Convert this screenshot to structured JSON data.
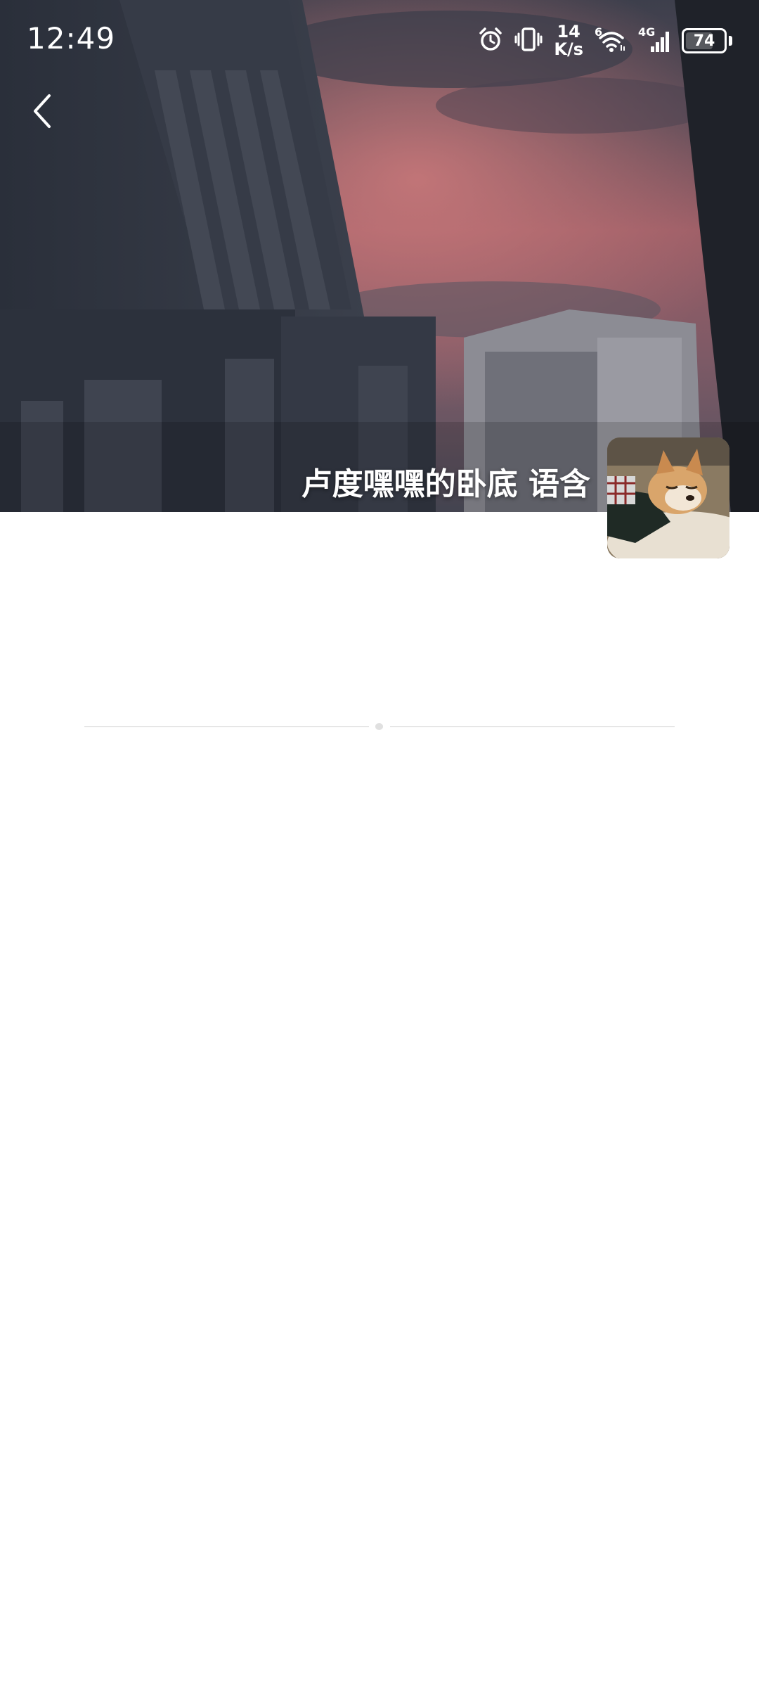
{
  "status_bar": {
    "time": "12:49",
    "net_speed_value": "14",
    "net_speed_unit": "K/s",
    "wifi_tag": "6",
    "cell_tag": "4G",
    "battery_level": "74",
    "battery_fraction": 0.74,
    "icons": [
      "alarm-icon",
      "vibrate-icon",
      "wifi-icon",
      "cell-signal-icon",
      "battery-icon"
    ]
  },
  "header": {
    "back_icon": "chevron-left-icon",
    "profile_name": "卢度嘿嘿的卧底 语含",
    "avatar_desc": "shiba-dog-avatar"
  },
  "colors": {
    "sky_top": "#3a3f4e",
    "sky_pink": "#b46d72",
    "building_dark": "#2f3440",
    "background": "#ffffff",
    "divider": "#e6e6e6"
  }
}
